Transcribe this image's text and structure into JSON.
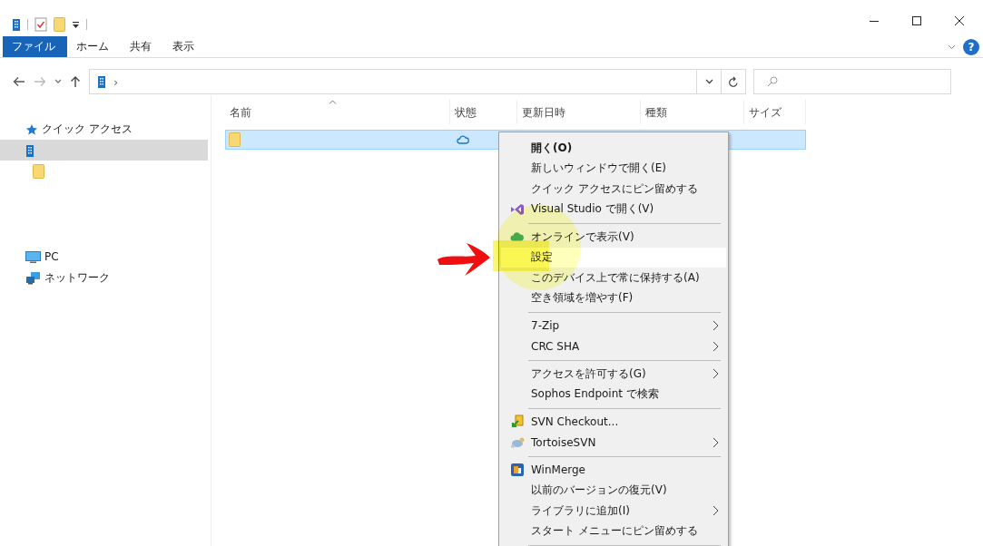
{
  "title_bar": {
    "quick_access_icons": [
      {
        "kind": "building"
      },
      {
        "kind": "checklist"
      },
      {
        "kind": "folder"
      },
      {
        "kind": "dropdown"
      }
    ]
  },
  "ribbon": {
    "tabs": [
      {
        "label": "ファイル",
        "selected": true
      },
      {
        "label": "ホーム",
        "selected": false
      },
      {
        "label": "共有",
        "selected": false
      },
      {
        "label": "表示",
        "selected": false
      }
    ],
    "help": "?"
  },
  "address_bar": {
    "separator": "›"
  },
  "sidebar": {
    "items": [
      {
        "kind": "star",
        "label": "クイック アクセス",
        "selected": false
      },
      {
        "kind": "building",
        "selected": true,
        "children": [
          {
            "kind": "folder",
            "selected": false
          }
        ]
      },
      {
        "kind": "pc",
        "label": "PC",
        "selected": false
      },
      {
        "kind": "network",
        "label": "ネットワーク",
        "selected": false
      }
    ]
  },
  "file_list": {
    "columns": [
      {
        "label": "名前",
        "sorted": true
      },
      {
        "label": "状態",
        "sorted": false
      },
      {
        "label": "更新日時",
        "sorted": false
      },
      {
        "label": "種類",
        "sorted": false
      },
      {
        "label": "サイズ",
        "sorted": false
      }
    ],
    "rows": [
      {
        "selected": true
      }
    ]
  },
  "context_menu": {
    "groups": [
      {
        "items": [
          {
            "kind": "plain",
            "label": "開く(O)",
            "default": true,
            "selected": false
          },
          {
            "kind": "plain",
            "label": "新しいウィンドウで開く(E)",
            "default": false,
            "selected": false
          },
          {
            "kind": "plain",
            "label": "クイック アクセスにピン留めする",
            "default": false,
            "selected": false
          },
          {
            "kind": "vs",
            "label": "Visual Studio で開く(V)",
            "default": false,
            "selected": false
          }
        ]
      },
      {
        "items": [
          {
            "kind": "cloud",
            "label": "オンラインで表示(V)",
            "default": false,
            "selected": false
          },
          {
            "kind": "plain",
            "label": "設定",
            "default": false,
            "selected": true
          },
          {
            "kind": "plain",
            "label": "このデバイス上で常に保持する(A)",
            "default": false,
            "selected": false
          },
          {
            "kind": "plain",
            "label": "空き領域を増やす(F)",
            "default": false,
            "selected": false
          }
        ]
      },
      {
        "items": [
          {
            "kind": "plain",
            "label": "7-Zip",
            "submenu": true,
            "default": false,
            "selected": false
          },
          {
            "kind": "plain",
            "label": "CRC SHA",
            "submenu": true,
            "default": false,
            "selected": false
          }
        ]
      },
      {
        "items": [
          {
            "kind": "plain",
            "label": "アクセスを許可する(G)",
            "submenu": true,
            "default": false,
            "selected": false
          },
          {
            "kind": "plain",
            "label": "Sophos Endpoint で検索",
            "default": false,
            "selected": false
          }
        ]
      },
      {
        "items": [
          {
            "kind": "svn",
            "label": "SVN Checkout...",
            "default": false,
            "selected": false
          },
          {
            "kind": "tortoise",
            "label": "TortoiseSVN",
            "submenu": true,
            "default": false,
            "selected": false
          }
        ]
      },
      {
        "items": [
          {
            "kind": "winmerge",
            "label": "WinMerge",
            "default": false,
            "selected": false
          },
          {
            "kind": "plain",
            "label": "以前のバージョンの復元(V)",
            "default": false,
            "selected": false
          },
          {
            "kind": "plain",
            "label": "ライブラリに追加(I)",
            "submenu": true,
            "default": false,
            "selected": false
          },
          {
            "kind": "plain",
            "label": "スタート メニューにピン留めする",
            "default": false,
            "selected": false
          }
        ]
      }
    ]
  }
}
